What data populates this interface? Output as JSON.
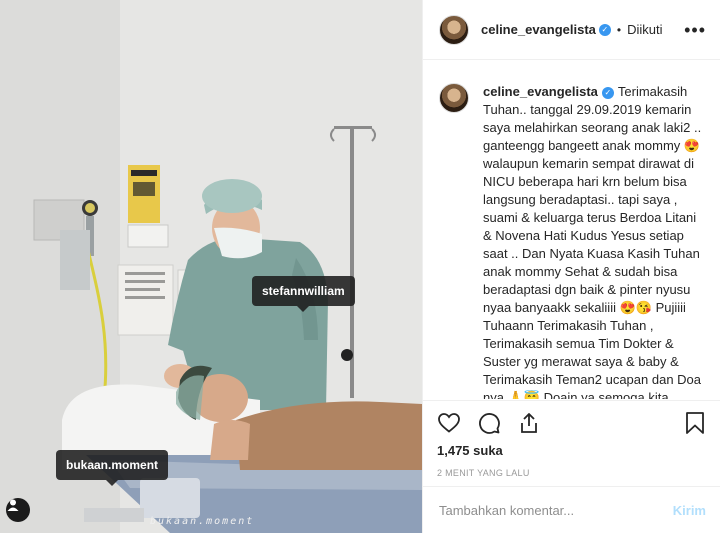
{
  "post": {
    "username": "celine_evangelista",
    "follow_status": "Diikuti",
    "more_label": "•••",
    "separator": "•",
    "caption_parts": [
      "Terimakasih Tuhan.. tanggal 29.09.2019 kemarin saya melahirkan seorang anak laki2 .. ganteengg bangeett anak mommy ",
      "😍",
      " walaupun kemarin sempat dirawat di NICU beberapa hari krn belum bisa langsung beradaptasi.. tapi saya , suami & keluarga terus Berdoa Litani & Novena Hati Kudus Yesus setiap saat .. Dan Nyata Kuasa Kasih Tuhan anak mommy Sehat & sudah bisa beradaptasi dgn baik & pinter nyusu nyaa banyaakk sekaliiii ",
      "😍😘",
      " Pujiiii Tuhaann Terimakasih Tuhan , Terimakasih semua Tim Dokter & Suster yg merawat saya & baby & Terimakasih Teman2 ucapan dan Doa nya ",
      "🙏😇",
      " Doain ya semoga kita sekeluarga selalu Sehat Amiiinnn ",
      "❤️"
    ],
    "likes": "1,475 suka",
    "time": "2 MENIT YANG LALU"
  },
  "photo": {
    "tags": [
      "stefannwilliam",
      "bukaan.moment"
    ],
    "watermark": "bukaan.moment"
  },
  "comment_box": {
    "placeholder": "Tambahkan komentar...",
    "post_label": "Kirim"
  },
  "colors": {
    "verified": "#3897f0",
    "post_disabled": "#b2dffc",
    "border": "#efefef",
    "heart_emoji": "#ed4956"
  },
  "icons": [
    "heart-icon",
    "comment-icon",
    "share-icon",
    "bookmark-icon",
    "verified-badge-icon",
    "user-tag-icon"
  ]
}
